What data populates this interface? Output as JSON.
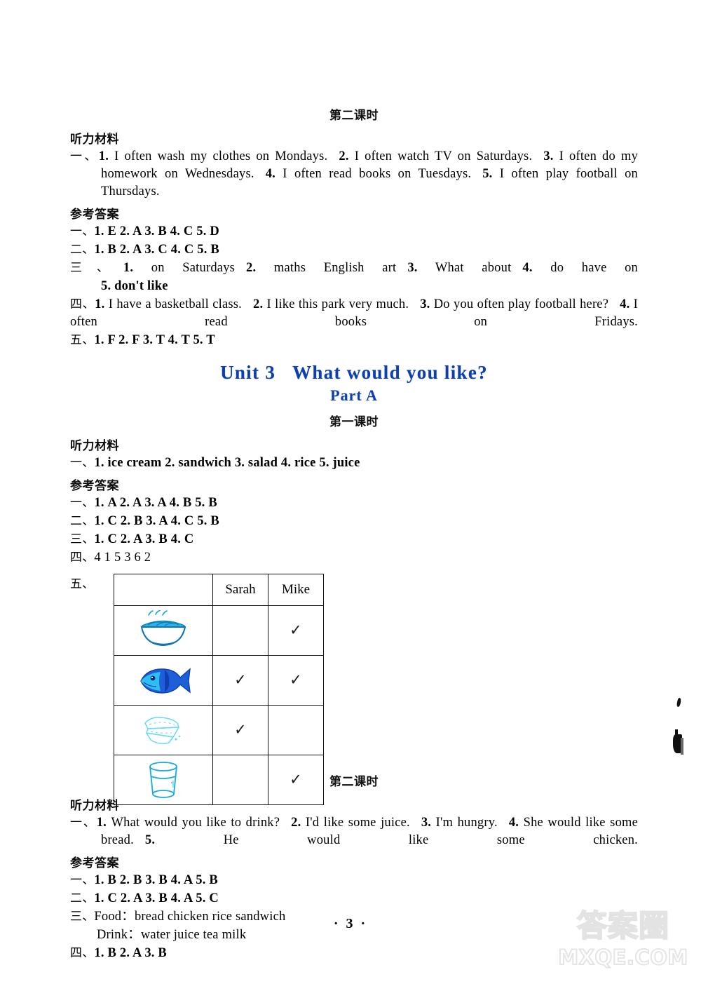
{
  "page": {
    "number": "· 3 ·",
    "watermark_cn": "答案圈",
    "watermark_url": "MXQE.COM",
    "accent_blue": "#0d3fae"
  },
  "unit2_part_b": {
    "lesson_heading": "第二课时",
    "listening_heading": "听力材料",
    "listening": {
      "marker": "一、",
      "items": [
        {
          "n": "1.",
          "text": "I often wash my clothes on Mondays."
        },
        {
          "n": "2.",
          "text": "I often watch TV on Saturdays."
        },
        {
          "n": "3.",
          "text": "I often do my homework on Wednesdays."
        },
        {
          "n": "4.",
          "text": "I often read books on Tuesdays."
        },
        {
          "n": "5.",
          "text": "I often play football on Thursdays."
        }
      ]
    },
    "answers_heading": "参考答案",
    "answers": [
      {
        "marker": "一、",
        "text": "1. E  2. A  3. B  4. C  5. D"
      },
      {
        "marker": "二、",
        "text": "1. B  2. A  3. C  4. C  5. B"
      },
      {
        "marker": "三、",
        "parts": [
          {
            "n": "1.",
            "text": "on Saturdays"
          },
          {
            "n": "2.",
            "text": "maths   English   art"
          },
          {
            "n": "3.",
            "text": "What about"
          },
          {
            "n": "4.",
            "text": "do    have on"
          }
        ],
        "cont": "5. don't like"
      },
      {
        "marker": "四、",
        "parts": [
          {
            "n": "1.",
            "text": "I have a basketball class."
          },
          {
            "n": "2.",
            "text": "I like this park very much."
          },
          {
            "n": "3.",
            "text": "Do you often play football here?"
          },
          {
            "n": "4.",
            "text": "I often read books on Fridays."
          }
        ]
      },
      {
        "marker": "五、",
        "text": "1. F  2. F  3. T  4. T  5. T"
      }
    ]
  },
  "unit3": {
    "title_unit": "Unit 3",
    "title_text": "What would you like?",
    "part": "Part A"
  },
  "unit3_part_a_lesson1": {
    "lesson_heading": "第一课时",
    "listening_heading": "听力材料",
    "listening": {
      "marker": "一、",
      "text": "1. ice cream   2. sandwich   3. salad   4. rice   5. juice"
    },
    "answers_heading": "参考答案",
    "answers": [
      {
        "marker": "一、",
        "text": "1. A   2. A   3. A   4. B   5. B"
      },
      {
        "marker": "二、",
        "text": "1. C   2. B   3. A   4. C   5. B"
      },
      {
        "marker": "三、",
        "text": "1. C   2. A   3. B   4. C"
      },
      {
        "marker": "四、",
        "text": "4   1   5   3   6   2"
      }
    ],
    "table": {
      "marker": "五、",
      "columns": [
        "",
        "Sarah",
        "Mike"
      ],
      "tick_glyph": "✓",
      "rows": [
        {
          "icon": "noodle-bowl-icon",
          "sarah": "",
          "mike": "✓"
        },
        {
          "icon": "fish-icon",
          "sarah": "✓",
          "mike": "✓"
        },
        {
          "icon": "sandwich-icon",
          "sarah": "✓",
          "mike": ""
        },
        {
          "icon": "water-glass-icon",
          "sarah": "",
          "mike": "✓"
        }
      ]
    }
  },
  "unit3_part_a_lesson2": {
    "lesson_heading": "第二课时",
    "listening_heading": "听力材料",
    "listening": {
      "marker": "一、",
      "items": [
        {
          "n": "1.",
          "text": "What would you like to drink?"
        },
        {
          "n": "2.",
          "text": "I'd like some juice."
        },
        {
          "n": "3.",
          "text": "I'm hungry."
        },
        {
          "n": "4.",
          "text": "She would like some bread."
        },
        {
          "n": "5.",
          "text": "He would like some chicken."
        }
      ]
    },
    "answers_heading": "参考答案",
    "answers": [
      {
        "marker": "一、",
        "text": "1. B   2. B   3. B   4. A   5. B"
      },
      {
        "marker": "二、",
        "text": "1. C   2. A   3. B   4. A   5. C"
      },
      {
        "marker": "三、",
        "food_label": "Food：",
        "food": "bread   chicken   rice   sandwich",
        "drink_label": "Drink：",
        "drink": "water   juice   tea   milk"
      },
      {
        "marker": "四、",
        "text": "1. B   2. A   3. B"
      }
    ]
  }
}
